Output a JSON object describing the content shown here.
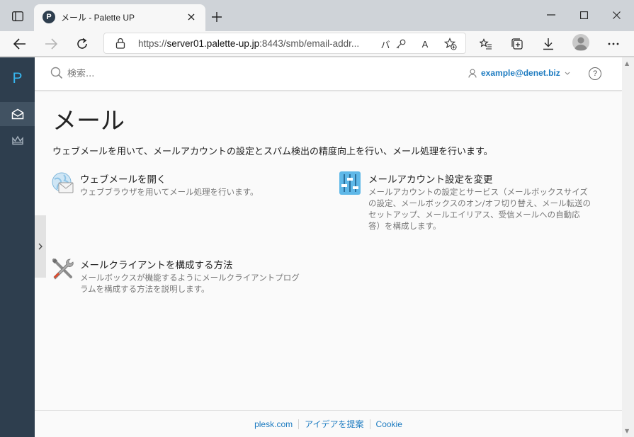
{
  "browser": {
    "tab_title": "メール - Palette UP",
    "tab_favicon": "P",
    "url_scheme": "https://",
    "url_host": "server01.palette-up.jp",
    "url_rest": ":8443/smb/email-addr...",
    "reader_mode_label": "バ",
    "read_aloud_label": "A",
    "icons": [
      "sidebar-icon",
      "close-icon",
      "plus-icon",
      "minimize-icon",
      "maximize-icon",
      "close-icon",
      "back-arrow-icon",
      "forward-arrow-icon",
      "refresh-icon",
      "lock-icon",
      "key-icon",
      "read-aloud-icon",
      "add-favorite-icon",
      "favorites-icon",
      "collections-icon",
      "download-icon",
      "profile-icon",
      "more-icon"
    ]
  },
  "app": {
    "logo": "P",
    "search_placeholder": "検索...",
    "user_email": "example@denet.biz",
    "help_label": "?",
    "page_title": "メール",
    "page_description": "ウェブメールを用いて、メールアカウントの設定とスパム検出の精度向上を行い、メール処理を行います。",
    "cards": [
      {
        "icon": "webmail-icon",
        "title": "ウェブメールを開く",
        "description": "ウェブブラウザを用いてメール処理を行います。"
      },
      {
        "icon": "settings-sliders-icon",
        "title": "メールアカウント設定を変更",
        "description_lines": [
          "メールアカウントの設定とサービス（メールボックスサイズ",
          "の設定、メールボックスのオン/オフ切り替え、メール転送の",
          "セットアップ、メールエイリアス、受信メールへの自動応",
          "答）を構成します。"
        ]
      },
      {
        "icon": "tools-icon",
        "title": "メールクライアントを構成する方法",
        "description_lines": [
          "メールボックスが機能するようにメールクライアントプログ",
          "ラムを構成する方法を説明します。"
        ]
      }
    ],
    "footer": {
      "links": [
        "plesk.com",
        "アイデアを提案",
        "Cookie"
      ]
    }
  },
  "colors": {
    "sidebar": "#2e3e4e",
    "accent": "#1e7cc1",
    "logo": "#37b6ef"
  }
}
